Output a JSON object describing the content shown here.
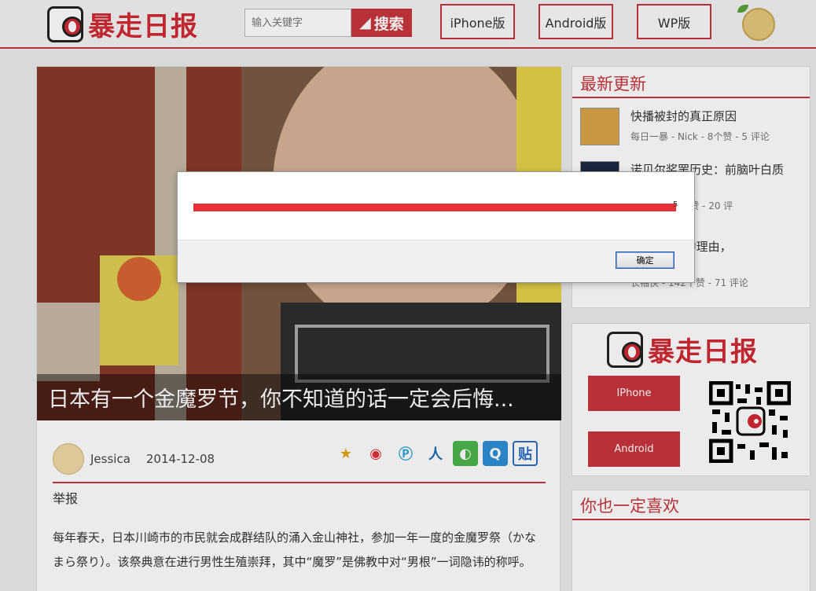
{
  "header": {
    "logo_text": "暴走日报",
    "search": {
      "placeholder": "输入关键字",
      "button_label": "搜索"
    },
    "nav": [
      {
        "label": "iPhone版"
      },
      {
        "label": "Android版"
      },
      {
        "label": "WP版"
      }
    ]
  },
  "article": {
    "hero_caption": "日本有一个金魔罗节，你不知道的话一定会后悔...",
    "author": "Jessica",
    "date": "2014-12-08",
    "report_label": "举报",
    "body": "每年春天，日本川崎市的市民就会成群结队的涌入金山神社，参加一年一度的金魔罗祭（かなまら祭り）。该祭典意在进行男性生殖崇拜，其中“魔罗”是佛教中对“男根”一词隐讳的称呼。",
    "share_icons": [
      "qzone-icon",
      "weibo-icon",
      "pengyou-icon",
      "renren-icon",
      "wechat-icon",
      "qq-icon",
      "tieba-icon"
    ]
  },
  "sidebar": {
    "latest": {
      "title": "最新更新",
      "items": [
        {
          "title": "快播被封的真正原因",
          "meta": "每日一暴 - Nick - 8个赞 - 5 评论"
        },
        {
          "title": "诺贝尔奖罢历史：前脑叶白质",
          "meta": "花盆儿 - 49个赞 - 20 评"
        },
        {
          "title": "弃 bilibili 的理由，",
          "meta": "长袖侠 - 142个赞 - 71 评论"
        }
      ]
    },
    "app": {
      "logo_text": "暴走日报",
      "iphone_label": "IPhone",
      "android_label": "Android"
    },
    "recommend": {
      "title": "你也一定喜欢"
    }
  },
  "dialog": {
    "message_fragment": "5",
    "ok_label": "确定"
  },
  "colors": {
    "brand": "#c9363d",
    "alert_bar": "#e53238"
  }
}
